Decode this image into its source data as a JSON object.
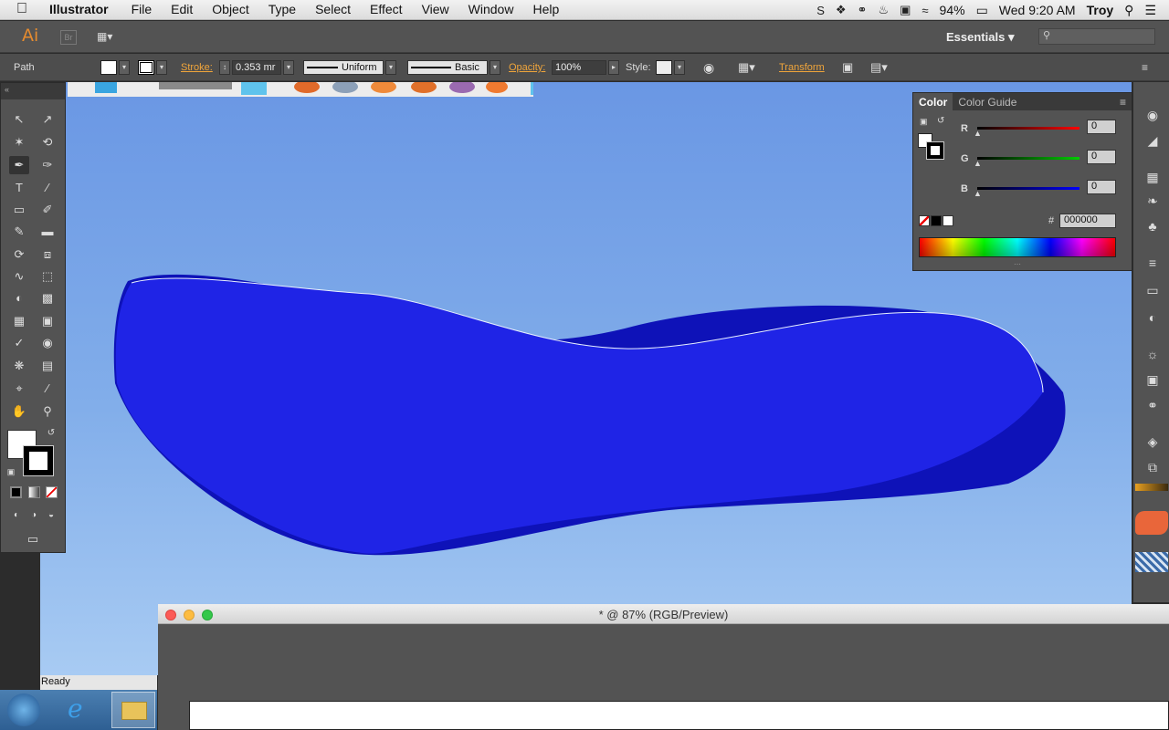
{
  "menubar": {
    "app_name": "Illustrator",
    "items": [
      "File",
      "Edit",
      "Object",
      "Type",
      "Select",
      "Effect",
      "View",
      "Window",
      "Help"
    ],
    "battery": "94%",
    "clock": "Wed 9:20 AM",
    "user": "Troy"
  },
  "appbar": {
    "logo": "Ai",
    "bridge": "Br",
    "workspace": "Essentials"
  },
  "control": {
    "selection_type": "Path",
    "stroke_label": "Stroke:",
    "stroke_value": "0.353 mr",
    "profile": "Uniform",
    "brush": "Basic",
    "opacity_label": "Opacity:",
    "opacity_value": "100%",
    "style_label": "Style:",
    "transform": "Transform"
  },
  "color_panel": {
    "tabs": [
      "Color",
      "Color Guide"
    ],
    "r_label": "R",
    "r_value": "0",
    "g_label": "G",
    "g_value": "0",
    "b_label": "B",
    "b_value": "0",
    "hex_label": "#",
    "hex_value": "000000"
  },
  "status": "Ready",
  "document": {
    "title": "* @ 87% (RGB/Preview)"
  },
  "colors": {
    "accent": "#f0a53b",
    "shape_fill": "#1f24e6",
    "canvas_top": "#6a97e4"
  }
}
